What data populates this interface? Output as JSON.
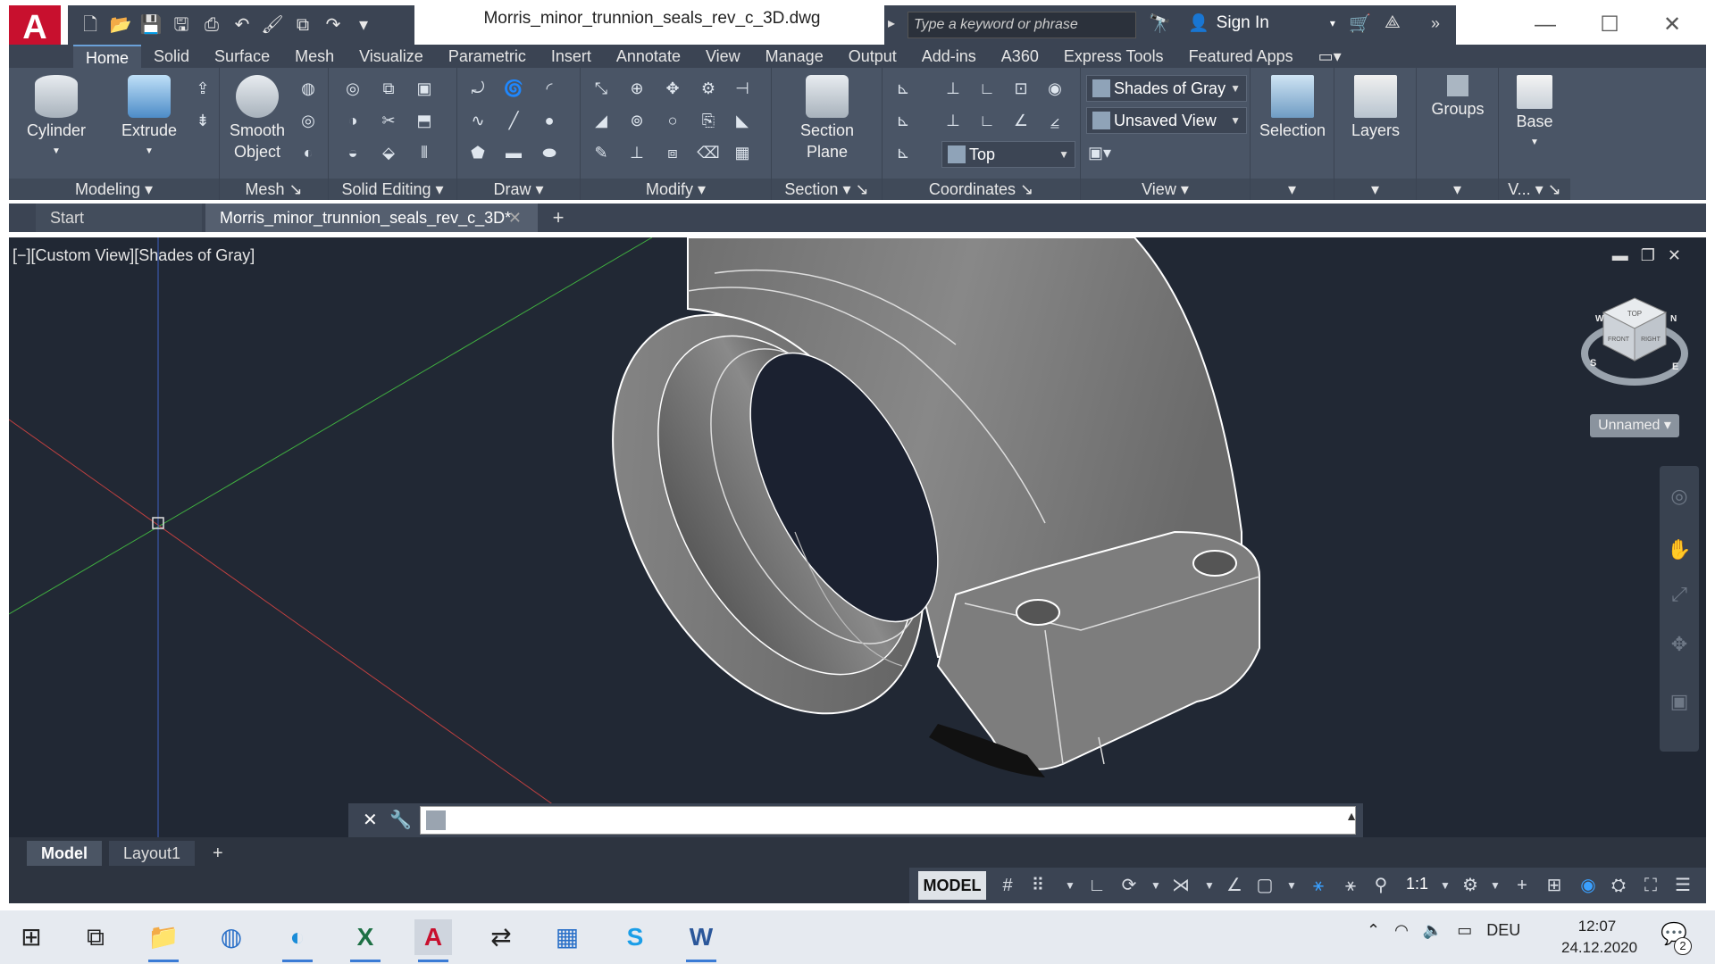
{
  "titlebar": {
    "doc_title": "Morris_minor_trunnion_seals_rev_c_3D.dwg",
    "search_placeholder": "Type a keyword or phrase",
    "sign_in": "Sign In",
    "app_logo": "A"
  },
  "ribbon_tabs": [
    "Home",
    "Solid",
    "Surface",
    "Mesh",
    "Visualize",
    "Parametric",
    "Insert",
    "Annotate",
    "View",
    "Manage",
    "Output",
    "Add-ins",
    "A360",
    "Express Tools",
    "Featured Apps"
  ],
  "ribbon": {
    "modeling": {
      "label": "Modeling",
      "cylinder": "Cylinder",
      "extrude": "Extrude"
    },
    "mesh": {
      "label": "Mesh",
      "smooth_object_line1": "Smooth",
      "smooth_object_line2": "Object"
    },
    "solid_editing": {
      "label": "Solid Editing"
    },
    "draw": {
      "label": "Draw"
    },
    "modify": {
      "label": "Modify"
    },
    "section": {
      "label": "Section",
      "section_plane_line1": "Section",
      "section_plane_line2": "Plane"
    },
    "coordinates": {
      "label": "Coordinates"
    },
    "view": {
      "label": "View",
      "visual_style": "Shades of Gray",
      "named_view": "Unsaved View",
      "viewpoint": "Top"
    },
    "selection": {
      "label": "Selection"
    },
    "layers": {
      "label": "Layers"
    },
    "groups": {
      "label": "Groups"
    },
    "base": {
      "label": "Base",
      "v_label": "V..."
    }
  },
  "file_tabs": {
    "start": "Start",
    "doc": "Morris_minor_trunnion_seals_rev_c_3D*"
  },
  "viewport": {
    "label": "[−][Custom View][Shades of Gray]",
    "viewcube_top": "TOP",
    "viewcube_front": "FRONT",
    "viewcube_right": "RIGHT",
    "compass_s": "S",
    "compass_e": "E",
    "compass_w": "W",
    "compass_n": "N",
    "named_ucs": "Unnamed"
  },
  "layout_tabs": {
    "model": "Model",
    "layout1": "Layout1"
  },
  "statusbar": {
    "model": "MODEL",
    "scale": "1:1"
  },
  "taskbar": {
    "language": "DEU",
    "time": "12:07",
    "date": "24.12.2020",
    "notifications": "2"
  },
  "colors": {
    "ribbon_bg": "#4a5566",
    "viewport_bg": "#212834",
    "x_axis": "#c04040",
    "y_axis": "#40b040",
    "z_axis": "#4060c0",
    "autocad_red": "#c8102e"
  }
}
